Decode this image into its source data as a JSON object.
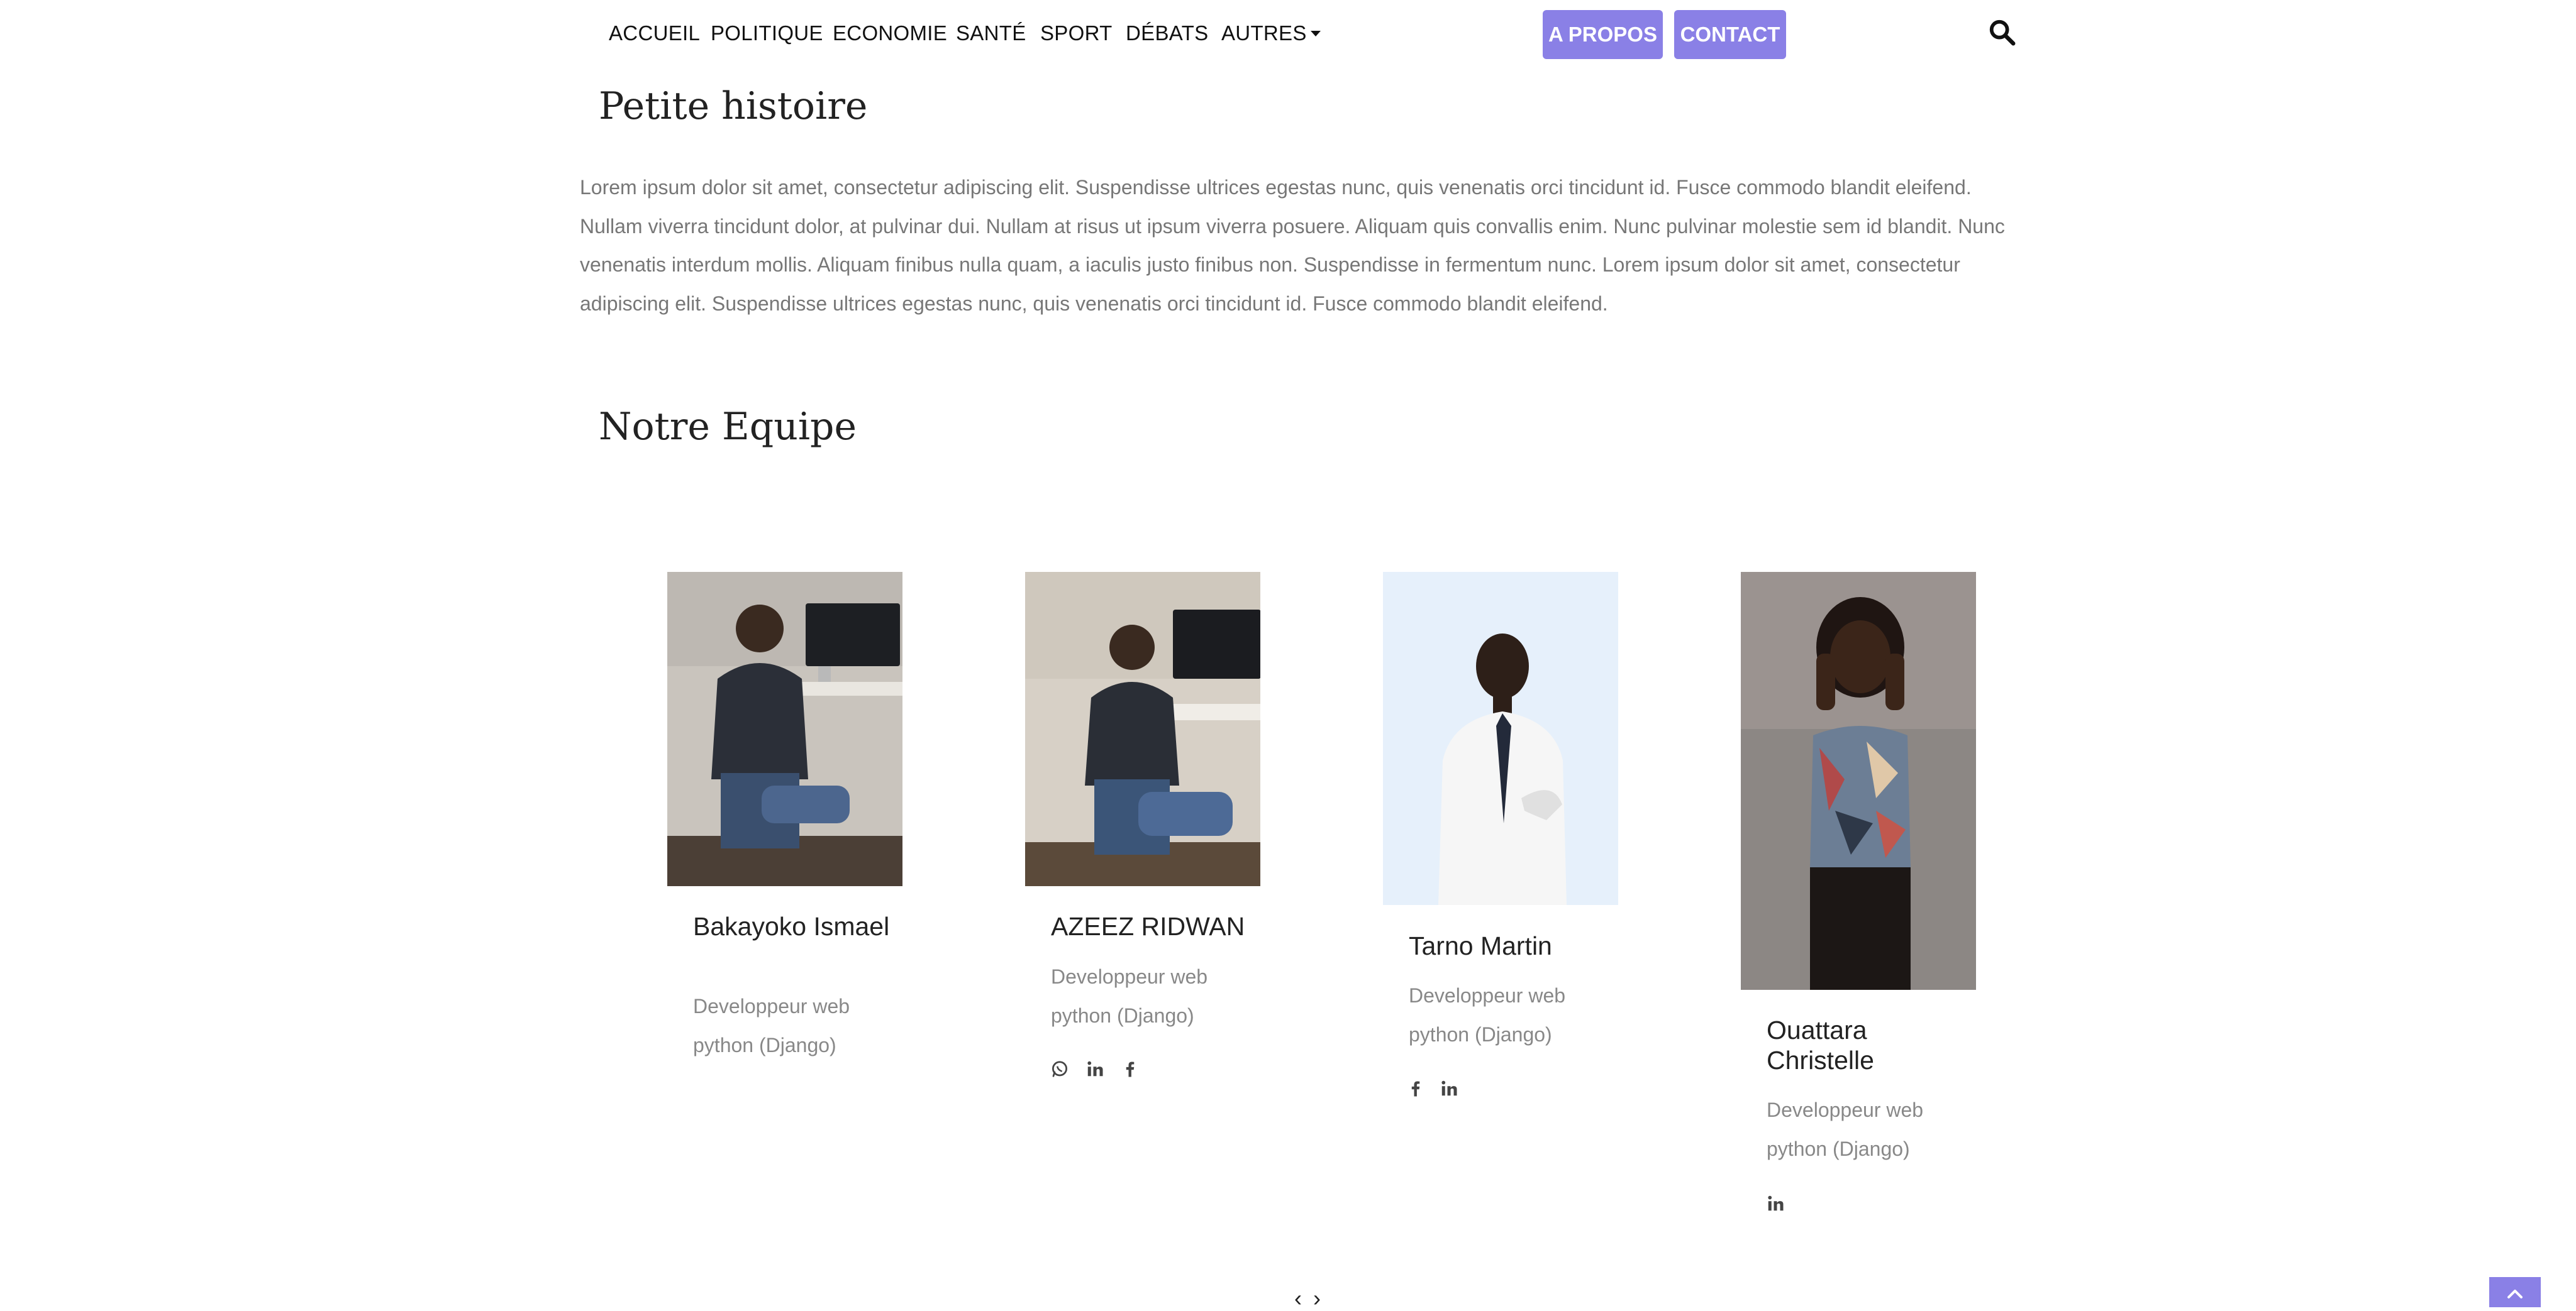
{
  "nav": {
    "links": [
      "ACCUEIL",
      "POLITIQUE",
      "ECONOMIE",
      "SANTÉ",
      "SPORT",
      "DÉBATS"
    ],
    "dropdown_label": "AUTRES",
    "about_button": "A PROPOS",
    "contact_button": "CONTACT",
    "accent_color": "#8a80e6"
  },
  "history": {
    "title": "Petite histoire",
    "text": "Lorem ipsum dolor sit amet, consectetur adipiscing elit. Suspendisse ultrices egestas nunc, quis venenatis orci tincidunt id. Fusce commodo blandit eleifend. Nullam viverra tincidunt dolor, at pulvinar dui. Nullam at risus ut ipsum viverra posuere. Aliquam quis convallis enim. Nunc pulvinar molestie sem id blandit. Nunc venenatis interdum mollis. Aliquam finibus nulla quam, a iaculis justo finibus non. Suspendisse in fermentum nunc. Lorem ipsum dolor sit amet, consectetur adipiscing elit. Suspendisse ultrices egestas nunc, quis venenatis orci tincidunt id. Fusce commodo blandit eleifend."
  },
  "team": {
    "title": "Notre Equipe",
    "members": [
      {
        "name": "Bakayoko Ismael",
        "role": "Developpeur web python (Django)",
        "socials": []
      },
      {
        "name": "AZEEZ RIDWAN",
        "role": "Developpeur web python (Django)",
        "socials": [
          "whatsapp-icon",
          "linkedin-icon",
          "facebook-icon"
        ]
      },
      {
        "name": "Tarno Martin",
        "role": "Developpeur web python (Django)",
        "socials": [
          "facebook-icon",
          "linkedin-icon"
        ]
      },
      {
        "name": "Ouattara Christelle",
        "role": "Developpeur web python (Django)",
        "socials": [
          "linkedin-icon"
        ]
      }
    ]
  },
  "carousel": {
    "prev": "‹",
    "next": "›"
  }
}
